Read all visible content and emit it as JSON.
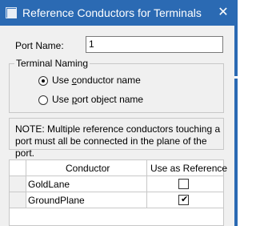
{
  "window": {
    "title": "Reference Conductors for Terminals",
    "close_glyph": "✕"
  },
  "port": {
    "label": "Port Name:",
    "value": "1"
  },
  "terminal_naming": {
    "title": "Terminal Naming",
    "options": [
      {
        "label_pre": "Use ",
        "label_mnemonic": "c",
        "label_post": "onductor name",
        "selected": true
      },
      {
        "label_pre": "Use ",
        "label_mnemonic": "p",
        "label_post": "ort object name",
        "selected": false
      }
    ]
  },
  "note": {
    "text": "NOTE: Multiple reference conductors touching a port must all be connected in the plane of the port."
  },
  "table": {
    "headers": [
      "Conductor",
      "Use as Reference"
    ],
    "rows": [
      {
        "conductor": "GoldLane",
        "use_as_reference": false
      },
      {
        "conductor": "GroundPlane",
        "use_as_reference": true
      }
    ],
    "check_glyph": "✔"
  }
}
